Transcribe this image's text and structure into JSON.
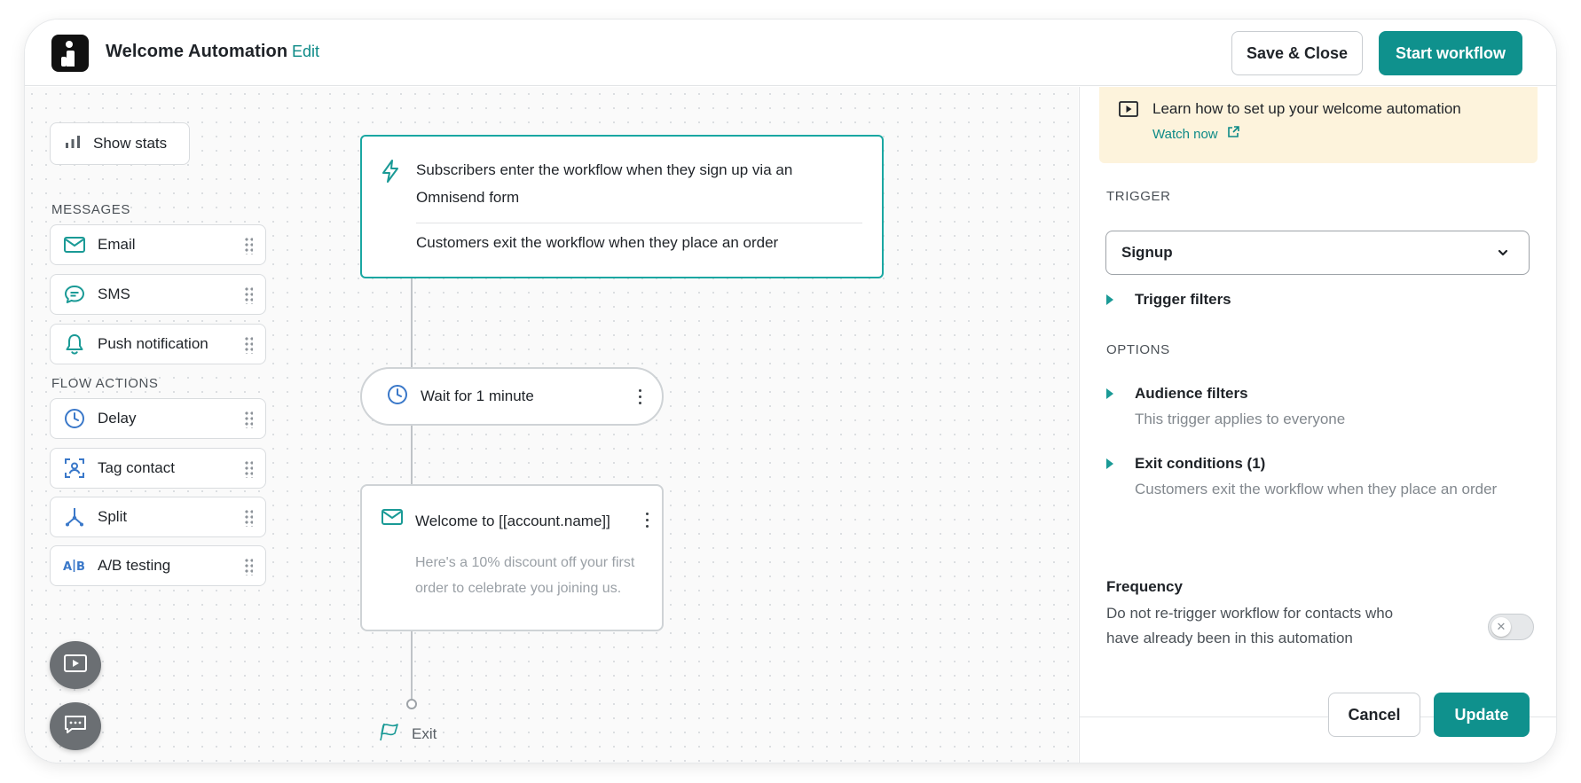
{
  "header": {
    "title": "Welcome Automation",
    "edit_label": "Edit",
    "save_close_label": "Save & Close",
    "start_label": "Start workflow"
  },
  "sidebar": {
    "show_stats_label": "Show stats",
    "messages_heading": "MESSAGES",
    "messages": [
      {
        "label": "Email",
        "icon": "envelope-icon"
      },
      {
        "label": "SMS",
        "icon": "chat-bubble-icon"
      },
      {
        "label": "Push notification",
        "icon": "bell-icon"
      }
    ],
    "flow_heading": "FLOW ACTIONS",
    "actions": [
      {
        "label": "Delay",
        "icon": "clock-icon"
      },
      {
        "label": "Tag contact",
        "icon": "tag-contact-icon"
      },
      {
        "label": "Split",
        "icon": "split-icon"
      },
      {
        "label": "A/B testing",
        "icon": "ab-testing-icon"
      }
    ]
  },
  "flow": {
    "trigger_text": "Subscribers enter the workflow when they sign up via an Omnisend form",
    "exit_rule_text": "Customers exit the workflow when they place an order",
    "wait_label": "Wait for 1 minute",
    "email_title": "Welcome to [[account.name]]",
    "email_preview": "Here's a 10% discount off your first order to celebrate you joining us.",
    "exit_label": "Exit"
  },
  "panel": {
    "promo_text": "Learn how to set up your welcome automation",
    "promo_link": "Watch now",
    "trigger_heading": "TRIGGER",
    "trigger_value": "Signup",
    "trigger_filters_label": "Trigger filters",
    "options_heading": "OPTIONS",
    "audience_title": "Audience filters",
    "audience_sub": "This trigger applies to everyone",
    "exit_title": "Exit conditions (1)",
    "exit_sub": "Customers exit the workflow when they place an order",
    "frequency_title": "Frequency",
    "frequency_text": "Do not re-trigger workflow for contacts who have already been in this automation",
    "frequency_enabled": false,
    "cancel_label": "Cancel",
    "update_label": "Update"
  },
  "colors": {
    "accent": "#0f918d",
    "promo_bg": "#fdf3dc",
    "trigger_border": "#1aa7a2"
  }
}
